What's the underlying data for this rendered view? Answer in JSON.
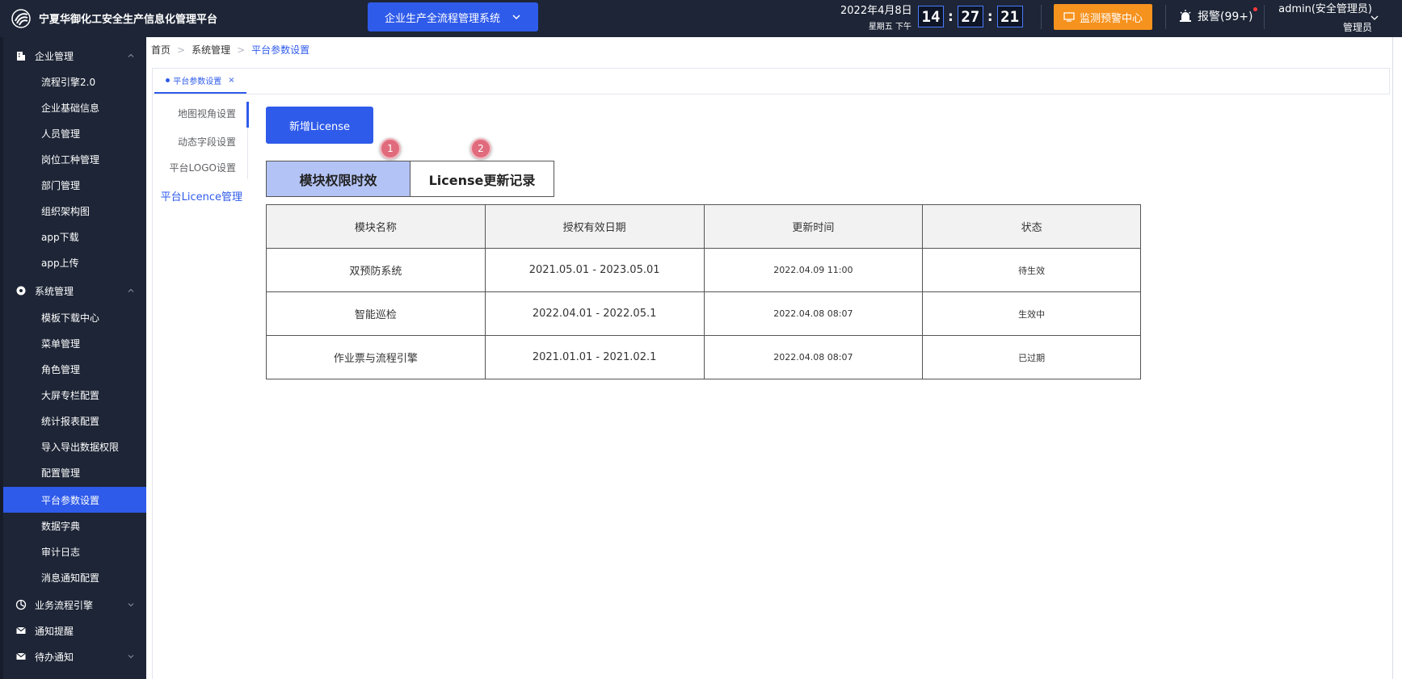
{
  "header": {
    "app_title": "宁夏华御化工安全生产信息化管理平台",
    "system_select": "企业生产全流程管理系统",
    "date": "2022年4月8日",
    "weekday": "星期五  下午",
    "clock": {
      "hh": "14",
      "mm": "27",
      "ss": "21"
    },
    "monitor_button": "监测预警中心",
    "alarm": "报警(99+)",
    "user_name": "admin(安全管理员)",
    "user_role": "管理员",
    "colors": {
      "topbar": "#1d2536",
      "primary": "#2f5bea",
      "monitor": "#f6921e"
    }
  },
  "sidebar": {
    "groups": [
      {
        "label": "企业管理",
        "icon": "building-icon",
        "items": [
          "流程引擎2.0",
          "企业基础信息",
          "人员管理",
          "岗位工种管理",
          "部门管理",
          "组织架构图",
          "app下载",
          "app上传"
        ]
      },
      {
        "label": "系统管理",
        "icon": "gear-icon",
        "items": [
          "模板下载中心",
          "菜单管理",
          "角色管理",
          "大屏专栏配置",
          "统计报表配置",
          "导入导出数据权限",
          "配置管理",
          "平台参数设置",
          "数据字典",
          "审计日志",
          "消息通知配置"
        ]
      },
      {
        "label": "业务流程引擎",
        "icon": "flow-icon",
        "items": []
      },
      {
        "label": "通知提醒",
        "icon": "mail-icon",
        "items": []
      },
      {
        "label": "待办通知",
        "icon": "mail-icon",
        "items": []
      }
    ],
    "active_item": "平台参数设置"
  },
  "breadcrumb": [
    "首页",
    "系统管理",
    "平台参数设置"
  ],
  "tab": {
    "label": "平台参数设置",
    "close": "×"
  },
  "settings_menu": [
    "地图视角设置",
    "动态字段设置",
    "平台LOGO设置",
    "平台Licence管理"
  ],
  "settings_selected": "平台Licence管理",
  "panel": {
    "add_button": "新增License",
    "badges": [
      "1",
      "2"
    ],
    "tabs": [
      "模块权限时效",
      "License更新记录"
    ],
    "active_tab": "模块权限时效"
  },
  "table": {
    "columns": [
      "模块名称",
      "授权有效日期",
      "更新时间",
      "状态"
    ],
    "rows": [
      [
        "双预防系统",
        "2021.05.01 - 2023.05.01",
        "2022.04.09  11:00",
        "待生效"
      ],
      [
        "智能巡检",
        "2022.04.01 - 2022.05.1",
        "2022.04.08  08:07",
        "生效中"
      ],
      [
        "作业票与流程引擎",
        "2021.01.01 - 2021.02.1",
        "2022.04.08 08:07",
        "已过期"
      ]
    ]
  }
}
